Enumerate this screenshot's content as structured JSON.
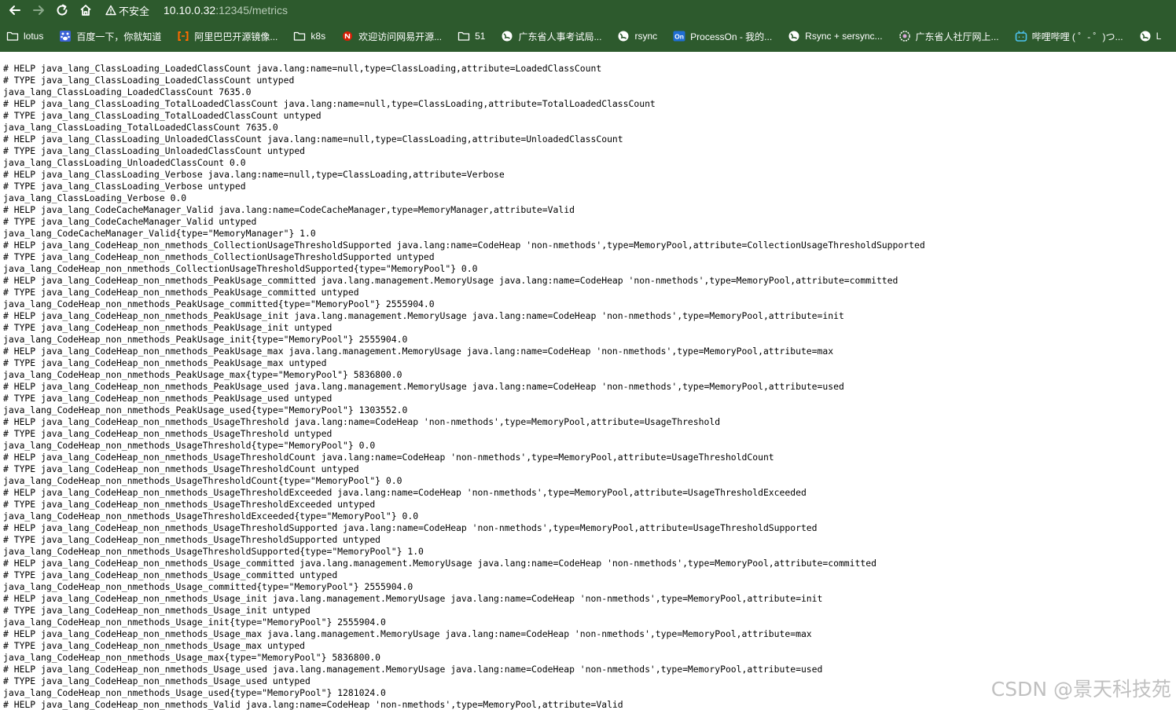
{
  "browser": {
    "security_label": "不安全",
    "url_host": "10.10.0.32",
    "url_path": ":12345/metrics",
    "bookmarks": [
      {
        "label": "lotus",
        "icon": "folder-icon"
      },
      {
        "label": "百度一下，你就知道",
        "icon": "baidu-icon"
      },
      {
        "label": "阿里巴巴开源镜像...",
        "icon": "alibaba-icon"
      },
      {
        "label": "k8s",
        "icon": "folder-icon"
      },
      {
        "label": "欢迎访问网易开源...",
        "icon": "netease-icon"
      },
      {
        "label": "51",
        "icon": "folder-icon"
      },
      {
        "label": "广东省人事考试局...",
        "icon": "globe-icon"
      },
      {
        "label": "rsync",
        "icon": "globe-icon"
      },
      {
        "label": "ProcessOn - 我的...",
        "icon": "processon-icon"
      },
      {
        "label": "Rsync + sersync...",
        "icon": "globe-icon"
      },
      {
        "label": "广东省人社厅网上...",
        "icon": "gear-globe-icon"
      },
      {
        "label": "哔哩哔哩 ( ゜- ゜)つ...",
        "icon": "bilibili-icon"
      },
      {
        "label": "L",
        "icon": "globe-icon"
      }
    ]
  },
  "colors": {
    "chrome_bg": "#2d5a2d",
    "page_bg": "#ffffff",
    "text": "#000000",
    "baidu_blue": "#3c63d8",
    "alibaba_orange": "#ff6a00",
    "netease_red": "#d81e06",
    "processon_blue": "#1f6ed4",
    "bilibili_blue": "#4cc3f0"
  },
  "metrics_lines": [
    "# HELP java_lang_ClassLoading_LoadedClassCount java.lang:name=null,type=ClassLoading,attribute=LoadedClassCount",
    "# TYPE java_lang_ClassLoading_LoadedClassCount untyped",
    "java_lang_ClassLoading_LoadedClassCount 7635.0",
    "# HELP java_lang_ClassLoading_TotalLoadedClassCount java.lang:name=null,type=ClassLoading,attribute=TotalLoadedClassCount",
    "# TYPE java_lang_ClassLoading_TotalLoadedClassCount untyped",
    "java_lang_ClassLoading_TotalLoadedClassCount 7635.0",
    "# HELP java_lang_ClassLoading_UnloadedClassCount java.lang:name=null,type=ClassLoading,attribute=UnloadedClassCount",
    "# TYPE java_lang_ClassLoading_UnloadedClassCount untyped",
    "java_lang_ClassLoading_UnloadedClassCount 0.0",
    "# HELP java_lang_ClassLoading_Verbose java.lang:name=null,type=ClassLoading,attribute=Verbose",
    "# TYPE java_lang_ClassLoading_Verbose untyped",
    "java_lang_ClassLoading_Verbose 0.0",
    "# HELP java_lang_CodeCacheManager_Valid java.lang:name=CodeCacheManager,type=MemoryManager,attribute=Valid",
    "# TYPE java_lang_CodeCacheManager_Valid untyped",
    "java_lang_CodeCacheManager_Valid{type=\"MemoryManager\"} 1.0",
    "# HELP java_lang_CodeHeap_non_nmethods_CollectionUsageThresholdSupported java.lang:name=CodeHeap 'non-nmethods',type=MemoryPool,attribute=CollectionUsageThresholdSupported",
    "# TYPE java_lang_CodeHeap_non_nmethods_CollectionUsageThresholdSupported untyped",
    "java_lang_CodeHeap_non_nmethods_CollectionUsageThresholdSupported{type=\"MemoryPool\"} 0.0",
    "# HELP java_lang_CodeHeap_non_nmethods_PeakUsage_committed java.lang.management.MemoryUsage java.lang:name=CodeHeap 'non-nmethods',type=MemoryPool,attribute=committed",
    "# TYPE java_lang_CodeHeap_non_nmethods_PeakUsage_committed untyped",
    "java_lang_CodeHeap_non_nmethods_PeakUsage_committed{type=\"MemoryPool\"} 2555904.0",
    "# HELP java_lang_CodeHeap_non_nmethods_PeakUsage_init java.lang.management.MemoryUsage java.lang:name=CodeHeap 'non-nmethods',type=MemoryPool,attribute=init",
    "# TYPE java_lang_CodeHeap_non_nmethods_PeakUsage_init untyped",
    "java_lang_CodeHeap_non_nmethods_PeakUsage_init{type=\"MemoryPool\"} 2555904.0",
    "# HELP java_lang_CodeHeap_non_nmethods_PeakUsage_max java.lang.management.MemoryUsage java.lang:name=CodeHeap 'non-nmethods',type=MemoryPool,attribute=max",
    "# TYPE java_lang_CodeHeap_non_nmethods_PeakUsage_max untyped",
    "java_lang_CodeHeap_non_nmethods_PeakUsage_max{type=\"MemoryPool\"} 5836800.0",
    "# HELP java_lang_CodeHeap_non_nmethods_PeakUsage_used java.lang.management.MemoryUsage java.lang:name=CodeHeap 'non-nmethods',type=MemoryPool,attribute=used",
    "# TYPE java_lang_CodeHeap_non_nmethods_PeakUsage_used untyped",
    "java_lang_CodeHeap_non_nmethods_PeakUsage_used{type=\"MemoryPool\"} 1303552.0",
    "# HELP java_lang_CodeHeap_non_nmethods_UsageThreshold java.lang:name=CodeHeap 'non-nmethods',type=MemoryPool,attribute=UsageThreshold",
    "# TYPE java_lang_CodeHeap_non_nmethods_UsageThreshold untyped",
    "java_lang_CodeHeap_non_nmethods_UsageThreshold{type=\"MemoryPool\"} 0.0",
    "# HELP java_lang_CodeHeap_non_nmethods_UsageThresholdCount java.lang:name=CodeHeap 'non-nmethods',type=MemoryPool,attribute=UsageThresholdCount",
    "# TYPE java_lang_CodeHeap_non_nmethods_UsageThresholdCount untyped",
    "java_lang_CodeHeap_non_nmethods_UsageThresholdCount{type=\"MemoryPool\"} 0.0",
    "# HELP java_lang_CodeHeap_non_nmethods_UsageThresholdExceeded java.lang:name=CodeHeap 'non-nmethods',type=MemoryPool,attribute=UsageThresholdExceeded",
    "# TYPE java_lang_CodeHeap_non_nmethods_UsageThresholdExceeded untyped",
    "java_lang_CodeHeap_non_nmethods_UsageThresholdExceeded{type=\"MemoryPool\"} 0.0",
    "# HELP java_lang_CodeHeap_non_nmethods_UsageThresholdSupported java.lang:name=CodeHeap 'non-nmethods',type=MemoryPool,attribute=UsageThresholdSupported",
    "# TYPE java_lang_CodeHeap_non_nmethods_UsageThresholdSupported untyped",
    "java_lang_CodeHeap_non_nmethods_UsageThresholdSupported{type=\"MemoryPool\"} 1.0",
    "# HELP java_lang_CodeHeap_non_nmethods_Usage_committed java.lang.management.MemoryUsage java.lang:name=CodeHeap 'non-nmethods',type=MemoryPool,attribute=committed",
    "# TYPE java_lang_CodeHeap_non_nmethods_Usage_committed untyped",
    "java_lang_CodeHeap_non_nmethods_Usage_committed{type=\"MemoryPool\"} 2555904.0",
    "# HELP java_lang_CodeHeap_non_nmethods_Usage_init java.lang.management.MemoryUsage java.lang:name=CodeHeap 'non-nmethods',type=MemoryPool,attribute=init",
    "# TYPE java_lang_CodeHeap_non_nmethods_Usage_init untyped",
    "java_lang_CodeHeap_non_nmethods_Usage_init{type=\"MemoryPool\"} 2555904.0",
    "# HELP java_lang_CodeHeap_non_nmethods_Usage_max java.lang.management.MemoryUsage java.lang:name=CodeHeap 'non-nmethods',type=MemoryPool,attribute=max",
    "# TYPE java_lang_CodeHeap_non_nmethods_Usage_max untyped",
    "java_lang_CodeHeap_non_nmethods_Usage_max{type=\"MemoryPool\"} 5836800.0",
    "# HELP java_lang_CodeHeap_non_nmethods_Usage_used java.lang.management.MemoryUsage java.lang:name=CodeHeap 'non-nmethods',type=MemoryPool,attribute=used",
    "# TYPE java_lang_CodeHeap_non_nmethods_Usage_used untyped",
    "java_lang_CodeHeap_non_nmethods_Usage_used{type=\"MemoryPool\"} 1281024.0",
    "# HELP java_lang_CodeHeap_non_nmethods_Valid java.lang:name=CodeHeap 'non-nmethods',type=MemoryPool,attribute=Valid"
  ],
  "watermark": "CSDN @景天科技苑"
}
